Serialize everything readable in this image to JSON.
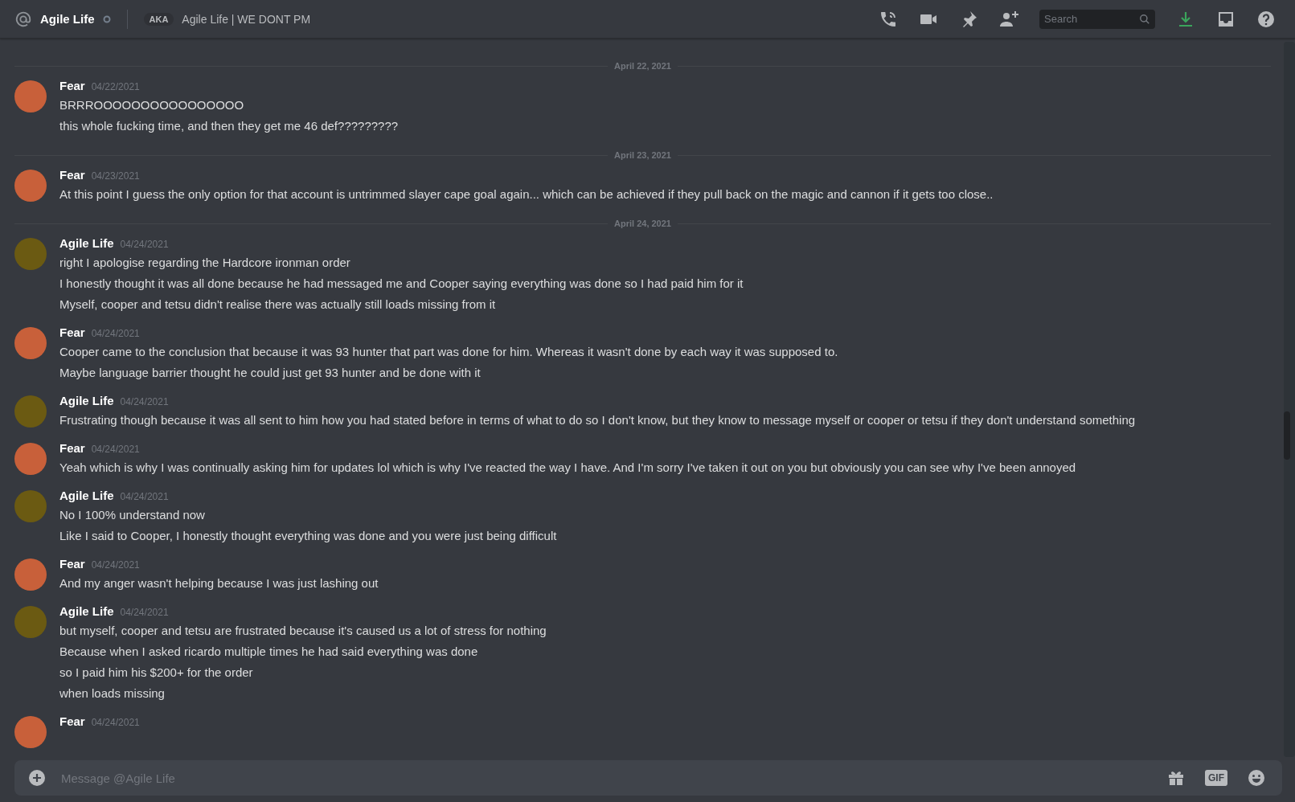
{
  "header": {
    "title": "Agile Life",
    "aka_badge": "AKA",
    "aka_text": "Agile Life | WE DONT PM",
    "search": {
      "placeholder": "Search"
    }
  },
  "items": [
    {
      "kind": "divider",
      "label": "April 22, 2021"
    },
    {
      "kind": "group",
      "author": "Fear",
      "color": "#c8603a",
      "time": "04/22/2021",
      "lines": [
        "BRRROOOOOOOOOOOOOOOO",
        "this whole fucking time, and then they get me 46 def?????????"
      ]
    },
    {
      "kind": "divider",
      "label": "April 23, 2021"
    },
    {
      "kind": "group",
      "author": "Fear",
      "color": "#c8603a",
      "time": "04/23/2021",
      "lines": [
        "At this point I guess the only option for that account is untrimmed slayer cape goal again... which can be achieved if they pull back on the magic and cannon if it gets too close.."
      ]
    },
    {
      "kind": "divider",
      "label": "April 24, 2021"
    },
    {
      "kind": "group",
      "author": "Agile Life",
      "color": "#6b5a12",
      "time": "04/24/2021",
      "lines": [
        "right I apologise regarding the Hardcore ironman order",
        "I honestly thought it was all done because he had messaged me and Cooper saying everything was done so I had paid him for it",
        "Myself, cooper and tetsu didn't realise there was actually still loads missing from it"
      ]
    },
    {
      "kind": "group",
      "author": "Fear",
      "color": "#c8603a",
      "time": "04/24/2021",
      "lines": [
        "Cooper came to the conclusion that because it was 93 hunter that part was done for him. Whereas it wasn't done by each way it was supposed to.",
        "Maybe language barrier thought he could just get 93 hunter and be done with it"
      ]
    },
    {
      "kind": "group",
      "author": "Agile Life",
      "color": "#6b5a12",
      "time": "04/24/2021",
      "lines": [
        "Frustrating though because it was all sent to him how you had stated before in terms of what to do so I don't know, but they know to message myself or cooper or tetsu if they don't understand something"
      ]
    },
    {
      "kind": "group",
      "author": "Fear",
      "color": "#c8603a",
      "time": "04/24/2021",
      "lines": [
        "Yeah which is why I was continually asking him for updates lol which is why I've reacted the way I have. And I'm sorry I've taken it out on you but obviously you can see why I've been annoyed"
      ]
    },
    {
      "kind": "group",
      "author": "Agile Life",
      "color": "#6b5a12",
      "time": "04/24/2021",
      "lines": [
        "No I 100% understand now",
        "Like I said to Cooper, I honestly thought everything was done and you were just being difficult"
      ]
    },
    {
      "kind": "group",
      "author": "Fear",
      "color": "#c8603a",
      "time": "04/24/2021",
      "lines": [
        "And my anger wasn't helping because I was just lashing out"
      ]
    },
    {
      "kind": "group",
      "author": "Agile Life",
      "color": "#6b5a12",
      "time": "04/24/2021",
      "lines": [
        "but myself, cooper and tetsu are frustrated because it's caused us a lot of stress for nothing",
        "Because when I asked ricardo multiple times he had said everything was done",
        "so I paid him his $200+ for the order",
        "when loads missing"
      ]
    },
    {
      "kind": "group",
      "author": "Fear",
      "color": "#c8603a",
      "time": "04/24/2021"
    }
  ],
  "composer": {
    "placeholder": "Message @Agile Life",
    "gif": "GIF"
  }
}
